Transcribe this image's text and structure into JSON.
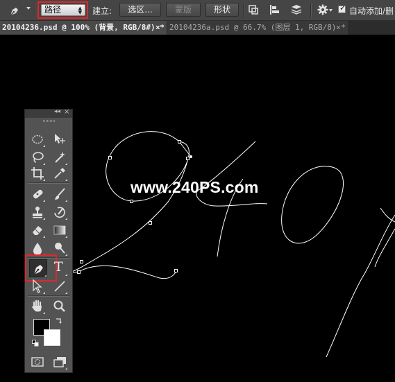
{
  "options_bar": {
    "tool_preset_icon": "pen-icon",
    "mode_value": "路径",
    "make_label": "建立:",
    "selection_button": "选区...",
    "mask_button": "蒙版",
    "shape_button": "形状",
    "path_operations_icon": "path-operations-icon",
    "path_alignment_icon": "path-alignment-icon",
    "path_arrangement_icon": "path-arrangement-icon",
    "settings_icon": "gear-icon",
    "auto_add_delete_checked": true,
    "auto_add_delete_label": "自动添加/删"
  },
  "tabs": [
    {
      "label": "20104236.psd @ 100% (背景, RGB/8#) *",
      "active": true,
      "close": "×"
    },
    {
      "label": "20104236a.psd @ 66.7% (图层 1, RGB/8) *",
      "active": false,
      "close": "×"
    }
  ],
  "canvas": {
    "background": "#000000",
    "watermark": "www.240PS.com",
    "path_color": "#ffffff"
  },
  "toolbox": {
    "collapse_glyph": "◂◂",
    "close_glyph": "×",
    "active_tool": "pen",
    "highlight_color": "#e0262b",
    "foreground_color": "#000000",
    "background_color": "#ffffff",
    "type_tool_glyph": "T"
  }
}
